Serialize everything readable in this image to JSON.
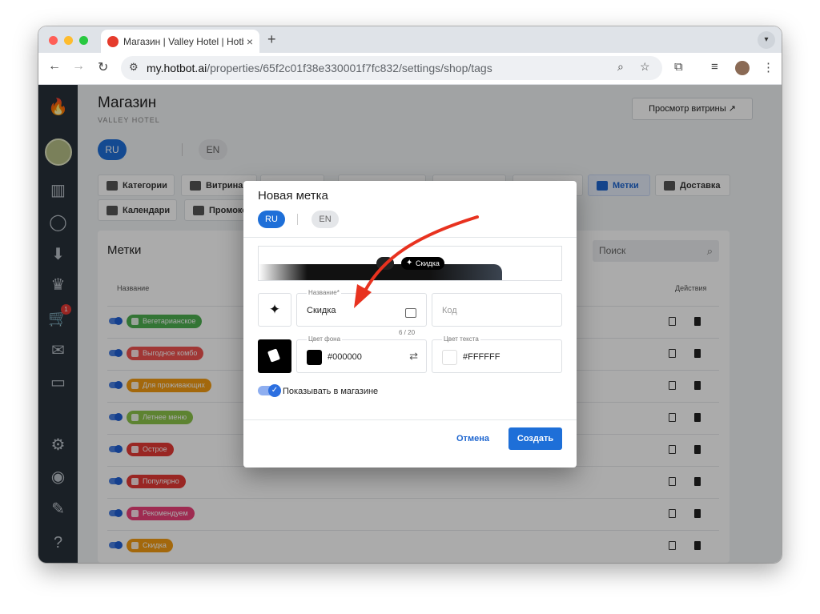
{
  "browser": {
    "tab_title": "Магазин | Valley Hotel | Hotbot",
    "close_glyph": "×",
    "newtab_glyph": "+",
    "url_host": "my.hotbot.ai",
    "url_path": "/properties/65f2c01f38e330001f7fc832/settings/shop/tags"
  },
  "header": {
    "title": "Магазин",
    "subtitle": "VALLEY HOTEL",
    "preview_button": "Просмотр витрины ↗"
  },
  "langs": {
    "ru": "RU",
    "en": "EN"
  },
  "nav_tabs": [
    {
      "label": "Категории"
    },
    {
      "label": "Витрина"
    },
    {
      "label": "Метки"
    },
    {
      "label": "Доставка"
    },
    {
      "label": "Календари"
    },
    {
      "label": "Промокоды"
    }
  ],
  "sidebar": {
    "cart_badge": "1"
  },
  "tags_card": {
    "title": "Метки",
    "search_placeholder": "Поиск",
    "col_name": "Название",
    "col_actions": "Действия",
    "rows": [
      {
        "label": "Вегетарианское",
        "color": "#4caf50"
      },
      {
        "label": "Выгодное комбо",
        "color": "#ef5350"
      },
      {
        "label": "Для проживающих",
        "color": "#f39c12"
      },
      {
        "label": "Летнее меню",
        "color": "#8bc34a"
      },
      {
        "label": "Острое",
        "color": "#e53935"
      },
      {
        "label": "Популярно",
        "color": "#e53935"
      },
      {
        "label": "Рекомендуем",
        "color": "#ec407a"
      },
      {
        "label": "Скидка",
        "color": "#f39c12"
      }
    ]
  },
  "modal": {
    "title": "Новая метка",
    "lang_ru": "RU",
    "lang_en": "EN",
    "preview_chip_label": "Скидка",
    "name_label": "Название*",
    "name_value": "Скидка",
    "name_counter": "6 / 20",
    "code_placeholder": "Код",
    "bg_color_label": "Цвет фона",
    "bg_color_value": "#000000",
    "text_color_label": "Цвет текста",
    "text_color_value": "#FFFFFF",
    "show_in_shop": "Показывать в магазине",
    "cancel": "Отмена",
    "create": "Создать",
    "icon": "sparkles-icon"
  },
  "colors": {
    "accent": "#1e6fd8",
    "annotation_arrow": "#e8321f"
  }
}
